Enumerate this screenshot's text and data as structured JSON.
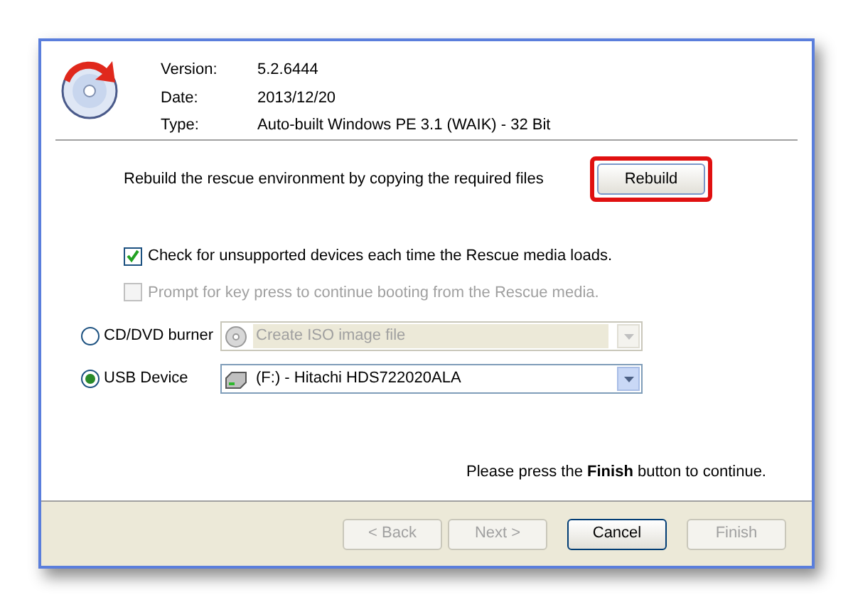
{
  "info": [
    {
      "label": "Version:",
      "value": "5.2.6444"
    },
    {
      "label": "Date:",
      "value": "2013/12/20"
    },
    {
      "label": "Type:",
      "value": "Auto-built Windows PE 3.1 (WAIK) - 32 Bit"
    }
  ],
  "rebuild": {
    "text": "Rebuild the rescue environment by copying the required files",
    "button": "Rebuild",
    "highlighted": true
  },
  "checkboxes": [
    {
      "label": "Check for unsupported devices each time the Rescue media loads.",
      "checked": true,
      "disabled": false
    },
    {
      "label": "Prompt for key press to continue booting from the Rescue media.",
      "checked": false,
      "disabled": true
    }
  ],
  "targets": [
    {
      "label": "CD/DVD burner",
      "selected": false,
      "value": "Create ISO image file",
      "disabled": true,
      "kind": "disc"
    },
    {
      "label": "USB Device",
      "selected": true,
      "value": "(F:) - Hitachi HDS722020ALA",
      "disabled": false,
      "kind": "drive"
    }
  ],
  "message": "Please press the **Finish** button to continue.",
  "buttons": [
    {
      "label": "< Back",
      "disabled": true
    },
    {
      "label": "Next >",
      "disabled": true
    },
    {
      "label": "Cancel",
      "disabled": false
    },
    {
      "label": "Finish",
      "disabled": true
    }
  ]
}
